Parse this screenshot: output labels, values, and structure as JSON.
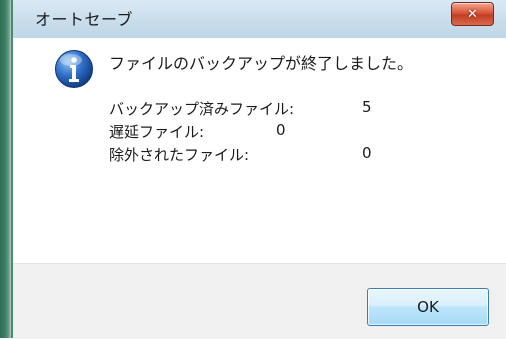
{
  "window": {
    "title": "オートセーブ",
    "close_icon": "close-icon"
  },
  "dialog": {
    "icon": "info-icon",
    "message": "ファイルのバックアップが終了しました。",
    "details": [
      {
        "label": "バックアップ済みファイル:",
        "value": "5"
      },
      {
        "label": "遅延ファイル:",
        "value": "0"
      },
      {
        "label": "除外されたファイル:",
        "value": "0"
      }
    ]
  },
  "buttons": {
    "ok_label": "OK"
  },
  "colors": {
    "titlebar": "#c9ddeb",
    "close_button": "#d8563a",
    "footer": "#f0f0f0",
    "ok_button_border": "#3c7fb1"
  }
}
